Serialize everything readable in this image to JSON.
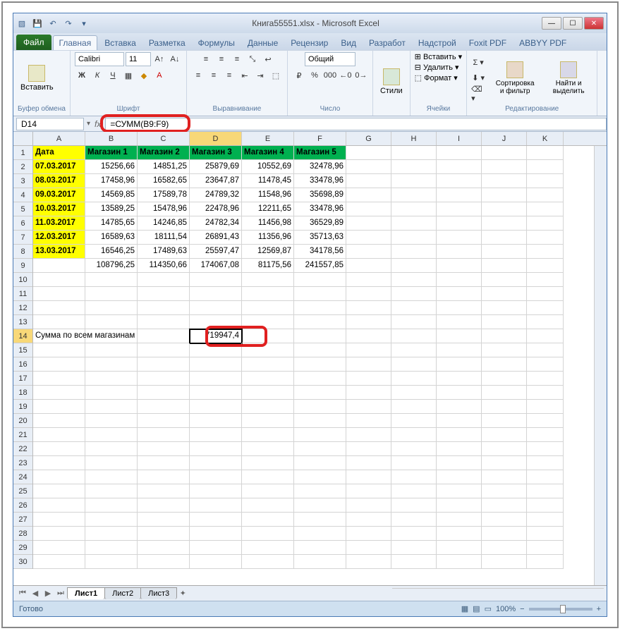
{
  "window": {
    "title": "Книга55551.xlsx - Microsoft Excel"
  },
  "ribbon": {
    "tabs": [
      "Файл",
      "Главная",
      "Вставка",
      "Разметка",
      "Формулы",
      "Данные",
      "Рецензир",
      "Вид",
      "Разработ",
      "Надстрой",
      "Foxit PDF",
      "ABBYY PDF"
    ],
    "active_tab": "Главная",
    "clipboard": {
      "paste": "Вставить",
      "label": "Буфер обмена"
    },
    "font": {
      "name": "Calibri",
      "size": "11",
      "label": "Шрифт"
    },
    "alignment": {
      "label": "Выравнивание"
    },
    "number": {
      "format": "Общий",
      "label": "Число"
    },
    "styles": {
      "btn": "Стили"
    },
    "cells": {
      "insert": "Вставить",
      "delete": "Удалить",
      "format": "Формат",
      "label": "Ячейки"
    },
    "editing": {
      "sort": "Сортировка и фильтр",
      "find": "Найти и выделить",
      "label": "Редактирование"
    }
  },
  "formula_bar": {
    "name_box": "D14",
    "formula": "=СУММ(B9:F9)"
  },
  "columns": [
    "A",
    "B",
    "C",
    "D",
    "E",
    "F",
    "G",
    "H",
    "I",
    "J",
    "K"
  ],
  "active_col": "D",
  "active_row": 14,
  "headers": {
    "A": "Дата",
    "B": "Магазин 1",
    "C": "Магазин 2",
    "D": "Магазин 3",
    "E": "Магазин 4",
    "F": "Магазин 5"
  },
  "rows": [
    {
      "A": "07.03.2017",
      "B": "15256,66",
      "C": "14851,25",
      "D": "25879,69",
      "E": "10552,69",
      "F": "32478,96"
    },
    {
      "A": "08.03.2017",
      "B": "17458,96",
      "C": "16582,65",
      "D": "23647,87",
      "E": "11478,45",
      "F": "33478,96"
    },
    {
      "A": "09.03.2017",
      "B": "14569,85",
      "C": "17589,78",
      "D": "24789,32",
      "E": "11548,96",
      "F": "35698,89"
    },
    {
      "A": "10.03.2017",
      "B": "13589,25",
      "C": "15478,96",
      "D": "22478,96",
      "E": "12211,65",
      "F": "33478,96"
    },
    {
      "A": "11.03.2017",
      "B": "14785,65",
      "C": "14246,85",
      "D": "24782,34",
      "E": "11456,98",
      "F": "36529,89"
    },
    {
      "A": "12.03.2017",
      "B": "16589,63",
      "C": "18111,54",
      "D": "26891,43",
      "E": "11356,96",
      "F": "35713,63"
    },
    {
      "A": "13.03.2017",
      "B": "16546,25",
      "C": "17489,63",
      "D": "25597,47",
      "E": "12569,87",
      "F": "34178,56"
    }
  ],
  "totals": {
    "B": "108796,25",
    "C": "114350,66",
    "D": "174067,08",
    "E": "81175,56",
    "F": "241557,85"
  },
  "sum_label": "Сумма по всем магазинам",
  "sum_value": "719947,4",
  "sheets": [
    "Лист1",
    "Лист2",
    "Лист3"
  ],
  "active_sheet": "Лист1",
  "status": {
    "ready": "Готово",
    "zoom": "100%"
  }
}
